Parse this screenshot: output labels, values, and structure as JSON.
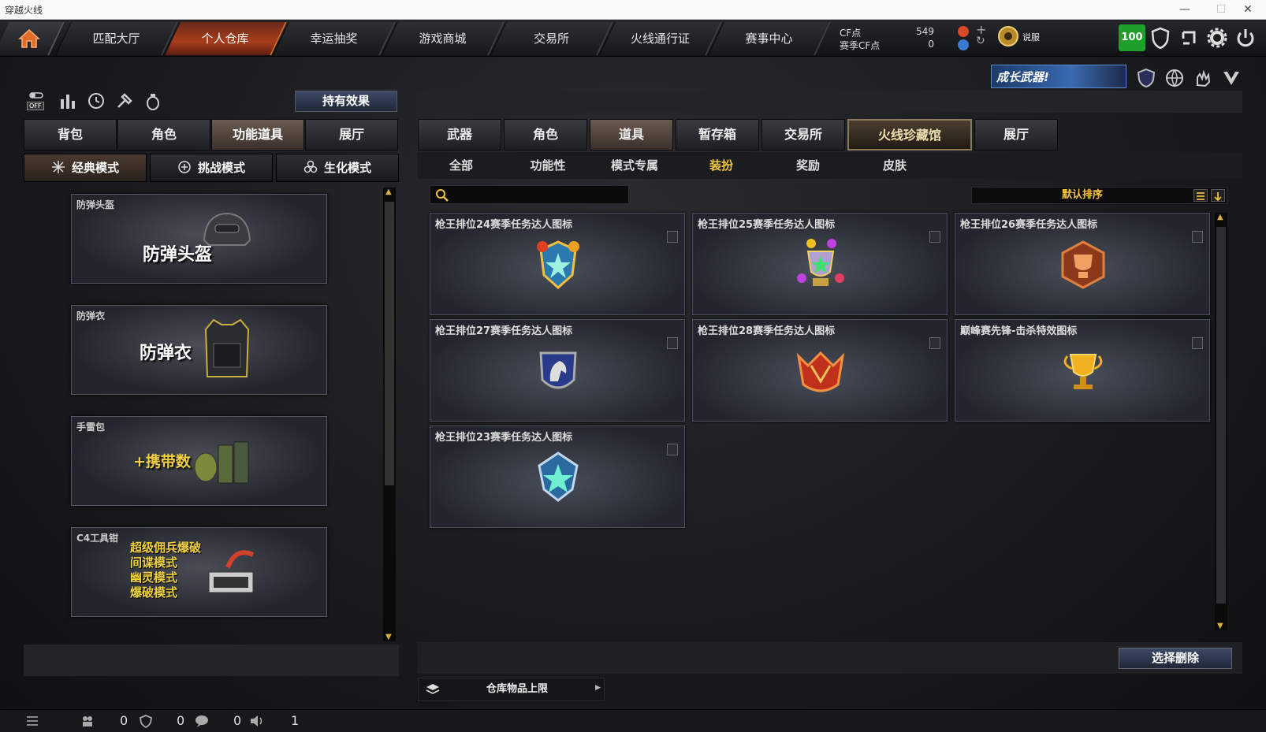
{
  "window": {
    "title": "穿越火线"
  },
  "nav": {
    "tabs": [
      "匹配大厅",
      "个人仓库",
      "幸运抽奖",
      "游戏商城",
      "交易所",
      "火线通行证",
      "赛事中心"
    ],
    "active_index": 1
  },
  "currency": {
    "cf_label": "CF点",
    "cf_value": "549",
    "season_label": "赛季CF点",
    "season_value": "0"
  },
  "rank": {
    "name": "说服"
  },
  "badge_level": "100",
  "promo_text": "成长武器!",
  "left": {
    "hold_effect_label": "持有效果",
    "tabs": [
      "背包",
      "角色",
      "功能道具",
      "展厅"
    ],
    "active_tab": 2,
    "modes": [
      "经典模式",
      "挑战模式",
      "生化模式"
    ],
    "active_mode": 0,
    "items": [
      {
        "caption": "防弹头盔",
        "text": "防弹头盔"
      },
      {
        "caption": "防弹衣",
        "text": "防弹衣"
      },
      {
        "caption": "手雷包",
        "text": "+携带数"
      },
      {
        "caption": "C4工具钳",
        "lines": [
          "超级佣兵爆破",
          "间谍模式",
          "幽灵模式",
          "爆破模式"
        ]
      }
    ],
    "toggle_off_label": "OFF"
  },
  "right": {
    "tabs": [
      "武器",
      "角色",
      "道具",
      "暂存箱",
      "交易所",
      "火线珍藏馆",
      "展厅"
    ],
    "active_tab": 2,
    "special_tab": 5,
    "subtabs": [
      "全部",
      "功能性",
      "模式专属",
      "装扮",
      "奖励",
      "皮肤"
    ],
    "active_subtab": 3,
    "search_placeholder": "",
    "sort_label": "默认排序",
    "items": [
      {
        "name": "枪王排位24赛季任务达人图标"
      },
      {
        "name": "枪王排位25赛季任务达人图标"
      },
      {
        "name": "枪王排位26赛季任务达人图标"
      },
      {
        "name": "枪王排位27赛季任务达人图标"
      },
      {
        "name": "枪王排位28赛季任务达人图标"
      },
      {
        "name": "巅峰赛先锋-击杀特效图标"
      },
      {
        "name": "枪王排位23赛季任务达人图标"
      }
    ],
    "delete_label": "选择删除",
    "capacity_label": "仓库物品上限"
  },
  "status": {
    "friends": "0",
    "clan": "0",
    "chat": "0",
    "volume": "1"
  }
}
